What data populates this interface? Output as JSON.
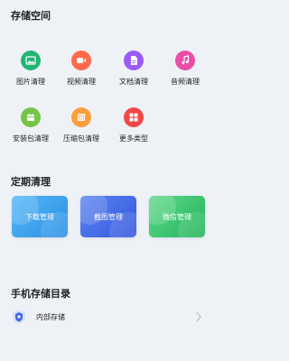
{
  "storage_space": {
    "title": "存储空间",
    "items": [
      {
        "label": "图片清理",
        "icon": "image-icon",
        "color": "#22b573"
      },
      {
        "label": "视频清理",
        "icon": "video-icon",
        "color": "#ff6b4a"
      },
      {
        "label": "文档清理",
        "icon": "document-icon",
        "color": "#9a5cf2"
      },
      {
        "label": "音频清理",
        "icon": "music-icon",
        "color": "#ea4ea7"
      },
      {
        "label": "安装包清理",
        "icon": "apk-package-icon",
        "color": "#76c448"
      },
      {
        "label": "压缩包清理",
        "icon": "zip-archive-icon",
        "color": "#ff9d3a"
      },
      {
        "label": "更多类型",
        "icon": "grid-more-icon",
        "color": "#f04848"
      }
    ]
  },
  "scheduled_cleanup": {
    "title": "定期清理",
    "cards": [
      {
        "label": "下载管理",
        "color": "#3aa3ee"
      },
      {
        "label": "截图管理",
        "color": "#3f69e8"
      },
      {
        "label": "微信管理",
        "color": "#39c86a"
      }
    ]
  },
  "phone_storage": {
    "title": "手机存储目录",
    "items": [
      {
        "label": "内部存储",
        "icon": "internal-storage-icon"
      }
    ]
  }
}
